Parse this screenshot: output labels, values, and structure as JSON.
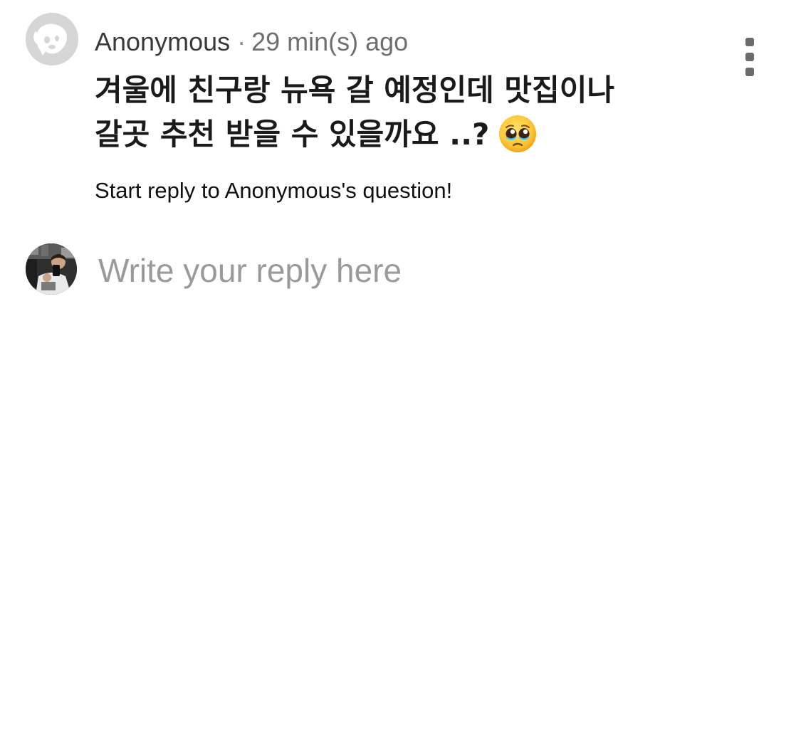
{
  "post": {
    "author": "Anonymous",
    "separator": "·",
    "time": "29 min(s) ago",
    "question_line1": "겨울에 친구랑 뉴욕 갈 예정인데 맛집이나",
    "question_line2": "갈곳 추천 받을 수 있을까요 ..?",
    "question_emoji": "pleading-face-with-tears-emoji",
    "anon_avatar_icon": "anonymous-dog-icon",
    "menu_icon": "more-vertical-icon"
  },
  "reply": {
    "prompt": "Start reply to Anonymous's question!",
    "placeholder": "Write your reply here",
    "avatar": "user-profile-photo"
  },
  "colors": {
    "background": "#ffffff",
    "text_primary": "#1a1a1a",
    "text_meta": "#6f6f6f",
    "placeholder": "#9a9a9a",
    "anon_avatar_bg": "#d6d6d6"
  }
}
